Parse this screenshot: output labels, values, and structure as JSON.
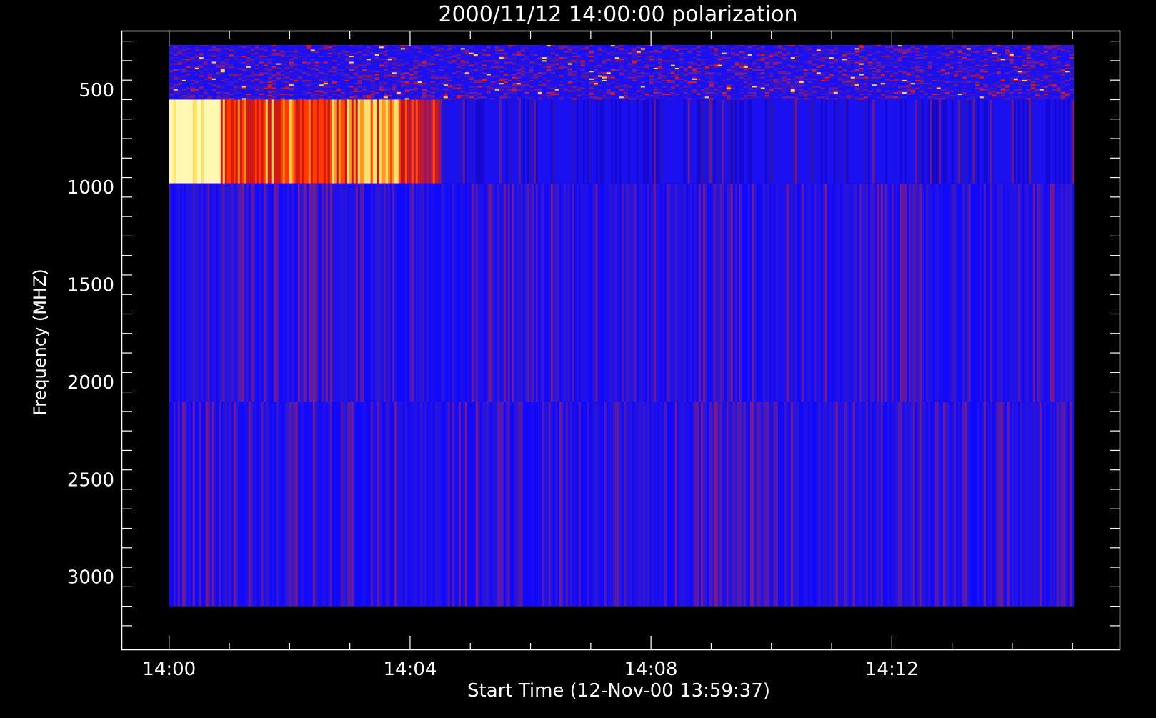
{
  "chart_data": {
    "type": "heatmap",
    "title": "2000/11/12 14:00:00 polarization",
    "xlabel": "Start Time (12-Nov-00 13:59:37)",
    "ylabel": "Frequency (MHZ)",
    "x_tick_labels": [
      "14:00",
      "14:04",
      "14:08",
      "14:12"
    ],
    "x_tick_values_min": [
      0,
      4,
      8,
      12
    ],
    "y_tick_labels": [
      "500",
      "1000",
      "1500",
      "2000",
      "2500",
      "3000"
    ],
    "y_tick_values": [
      500,
      1000,
      1500,
      2000,
      2500,
      3000
    ],
    "xlim_min": [
      -0.78,
      15.78
    ],
    "ylim_mhz": [
      3375,
      200
    ],
    "y_inverted": true,
    "data_extent": {
      "time_min": [
        0,
        15
      ],
      "freq_mhz": [
        270,
        3150
      ]
    },
    "bands": [
      {
        "name": "270-550 MHz",
        "freq_mhz": [
          270,
          550
        ],
        "description": "noisy blue/purple with sparse red and yellow speckle"
      },
      {
        "name": "550-980 MHz",
        "freq_mhz": [
          550,
          980
        ],
        "description": "strong polarization burst 14:00-14:05 fading to blue",
        "segments": [
          {
            "time_min": [
              0,
              0.85
            ],
            "level": "very high"
          },
          {
            "time_min": [
              0.85,
              2.6
            ],
            "level": "high (orange/red striped)"
          },
          {
            "time_min": [
              2.6,
              3.9
            ],
            "level": "high (yellow/orange striped)"
          },
          {
            "time_min": [
              3.9,
              4.5
            ],
            "level": "medium (red)"
          },
          {
            "time_min": [
              4.5,
              15
            ],
            "level": "low (blue)"
          }
        ]
      },
      {
        "name": "980-2100 MHz",
        "freq_mhz": [
          980,
          2100
        ],
        "description": "low (blue with faint vertical purple striping)"
      },
      {
        "name": "2100-3150 MHz",
        "freq_mhz": [
          2100,
          3150
        ],
        "description": "low (blue with faint vertical purple striping)"
      }
    ],
    "colormap": {
      "low": "#1a10f0",
      "mid": "#b01868",
      "high": "#ff4a00",
      "very_high": "#fff8b0"
    },
    "background": "#000000",
    "foreground": "#ffffff",
    "grid": false
  }
}
